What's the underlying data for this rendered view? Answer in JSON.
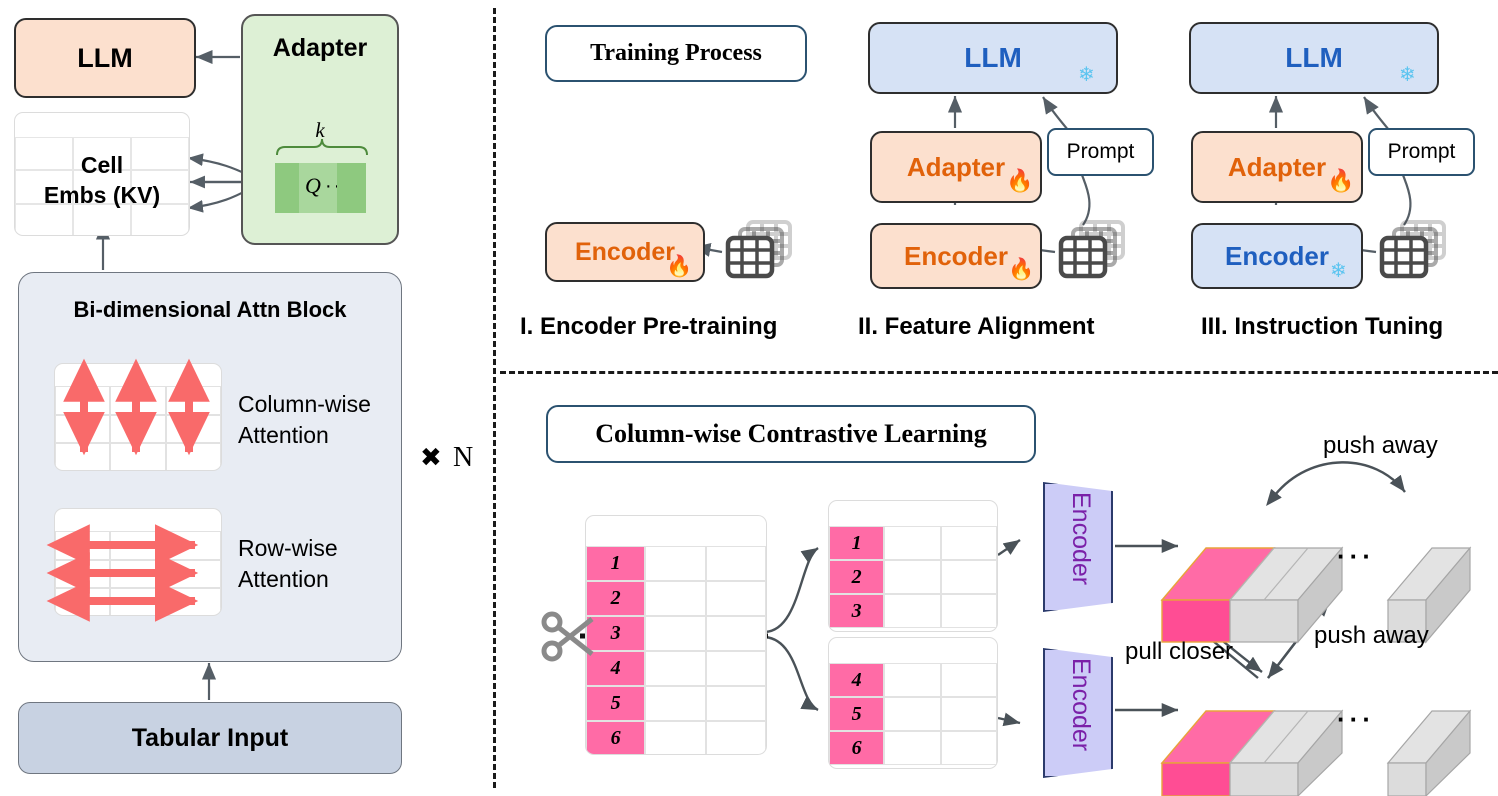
{
  "left_panel": {
    "llm_box": {
      "label": "LLM",
      "fill": "#FCE0CE",
      "text_color": "#000000"
    },
    "adapter_box": {
      "label": "Adapter",
      "fill": "#DDF0D5",
      "text_color": "#000000"
    },
    "adapter_brace_label": "k",
    "adapter_query_label": "Q",
    "adapter_query_ellipsis": "···",
    "cell_embs": {
      "line1": "Cell",
      "line2": "Embs (KV)"
    },
    "attn_block": {
      "title": "Bi-dimensional Attn Block",
      "column_attention": {
        "line1": "Column-wise",
        "line2": "Attention"
      },
      "row_attention": {
        "line1": "Row-wise",
        "line2": "Attention"
      },
      "fill": "#E8ECF3",
      "arrow_color": "#F96A6A"
    },
    "repeat_marker": {
      "symbol": "✖",
      "count": "N"
    },
    "tabular_input": {
      "label": "Tabular Input",
      "fill": "#C8D2E2"
    }
  },
  "training_process": {
    "title": "Training Process",
    "stages": [
      {
        "caption": "I. Encoder Pre-training",
        "blocks": [
          {
            "name": "encoder",
            "label": "Encoder",
            "fill": "#FCE0CE",
            "text_color": "#E1620A",
            "icon": "fire-icon"
          }
        ],
        "has_prompt": false,
        "prompt_label": "Prompt"
      },
      {
        "caption": "II. Feature Alignment",
        "blocks": [
          {
            "name": "llm",
            "label": "LLM",
            "fill": "#D6E2F5",
            "text_color": "#1F5FBF",
            "icon": "snowflake-icon"
          },
          {
            "name": "adapter",
            "label": "Adapter",
            "fill": "#FCE0CE",
            "text_color": "#E1620A",
            "icon": "fire-icon"
          },
          {
            "name": "encoder",
            "label": "Encoder",
            "fill": "#FCE0CE",
            "text_color": "#E1620A",
            "icon": "fire-icon"
          }
        ],
        "has_prompt": true,
        "prompt_label": "Prompt"
      },
      {
        "caption": "III. Instruction Tuning",
        "blocks": [
          {
            "name": "llm",
            "label": "LLM",
            "fill": "#D6E2F5",
            "text_color": "#1F5FBF",
            "icon": "snowflake-icon"
          },
          {
            "name": "adapter",
            "label": "Adapter",
            "fill": "#FCE0CE",
            "text_color": "#E1620A",
            "icon": "fire-icon"
          },
          {
            "name": "encoder",
            "label": "Encoder",
            "fill": "#D6E2F5",
            "text_color": "#1F5FBF",
            "icon": "snowflake-icon"
          }
        ],
        "has_prompt": true,
        "prompt_label": "Prompt"
      }
    ]
  },
  "contrastive": {
    "title": "Column-wise Contrastive Learning",
    "source_table_values": [
      "1",
      "2",
      "3",
      "4",
      "5",
      "6"
    ],
    "top_view_values": [
      "1",
      "2",
      "3"
    ],
    "bottom_view_values": [
      "4",
      "5",
      "6"
    ],
    "encoder_label_top": "Encoder",
    "encoder_label_bottom": "Encoder",
    "ellipsis": "···",
    "labels": {
      "push_away_top": "push away",
      "push_away_bottom": "push away",
      "pull_closer": "pull closer"
    },
    "colors": {
      "pink": "#FF6BA6",
      "encoder_fill": "#CCCCF7",
      "encoder_text": "#7A20A8"
    }
  }
}
